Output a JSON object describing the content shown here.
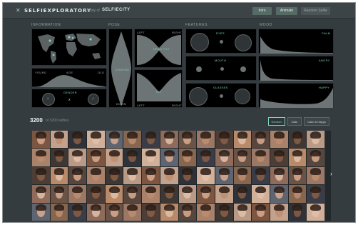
{
  "header": {
    "brand_mark": "✕",
    "logo": "SELFIEXPLORATORY",
    "byline": "a study of",
    "brand": "SELFIECITY",
    "buttons": [
      "Intro",
      "Animate",
      "Random Selfie"
    ]
  },
  "sections": {
    "demographics": "INFORMATION",
    "pose": "POSE",
    "features": "FEATURES",
    "mood": "MOOD"
  },
  "demographics": {
    "age_labels": [
      "YOUNG",
      "AGE",
      "OLD"
    ],
    "gender_label": "GENDER",
    "gender_symbols": [
      "♀",
      "♂"
    ]
  },
  "pose": {
    "top_labels": [
      "LEFT",
      "RIGHT"
    ],
    "center_label": "LOOKING",
    "bottom_label": "DOWN",
    "head_label": "HEAD TILT",
    "tilt_label": "TILT",
    "bottom_labels": [
      "LEFT",
      "RIGHT"
    ]
  },
  "features": {
    "eyes": "EYES",
    "mouth": "MOUTH",
    "glasses": "GLASSES"
  },
  "mood": {
    "calm": "CALM",
    "angry": "ANGRY",
    "happy": "HAPPY"
  },
  "results": {
    "count": "3200",
    "subtitle": "of 3200 selfies",
    "sort_buttons": [
      "Random",
      "Date",
      "Calm & Happy"
    ]
  },
  "tile_colors": [
    "#7d5642",
    "#b88a6a",
    "#3a3d48",
    "#c2a28c",
    "#56463e",
    "#8e6b5b",
    "#2f3238",
    "#a8826b",
    "#6a5448",
    "#d1b09a",
    "#3f3733",
    "#9b7866",
    "#5e6470",
    "#b99a86",
    "#4c3d36",
    "#87664f"
  ],
  "colors": {
    "accent": "#7fd0bd",
    "panel": "#000000",
    "background": "#353c40"
  }
}
